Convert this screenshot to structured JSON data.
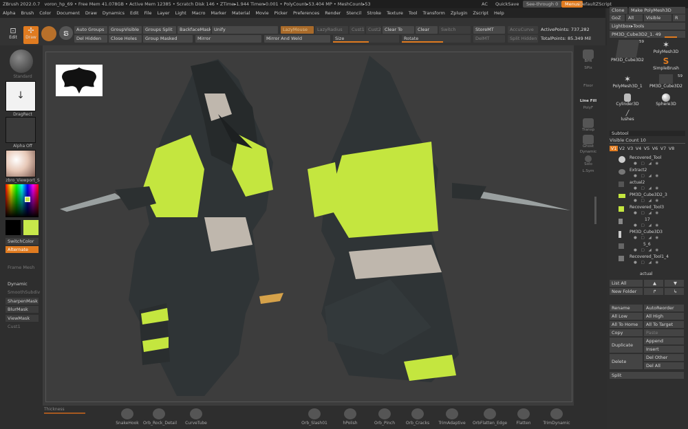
{
  "titlebar": {
    "app": "ZBrush 2022.0.7",
    "file": "voron_hp_69",
    "stats": "• Free Mem 41.078GB • Active Mem 12385 • Scratch Disk 146 • ZTime▸1.944 Timer▸0.001 • PolyCount▸53.404 MP • MeshCount▸53",
    "ac": "AC",
    "quicksave": "QuickSave",
    "seethrough": "See-through 0",
    "menus": "Menus",
    "script": "DefaultZScript"
  },
  "menubar": [
    "Alpha",
    "Brush",
    "Color",
    "Document",
    "Draw",
    "Dynamics",
    "Edit",
    "File",
    "Layer",
    "Light",
    "Macro",
    "Marker",
    "Material",
    "Movie",
    "Picker",
    "Preferences",
    "Render",
    "Stencil",
    "Stroke",
    "Texture",
    "Tool",
    "Transform",
    "Zplugin",
    "Zscript",
    "Help"
  ],
  "toolbar": {
    "edit": "Edit",
    "draw": "Draw",
    "auto_groups": "Auto Groups",
    "group_visible": "GroupVisible",
    "groups_split": "Groups Split",
    "backface_mask": "BackfaceMask",
    "unify": "Unify",
    "lazy_mouse": "LazyMouse",
    "lazy_radius": "LazyRadius",
    "cust1": "Cust1",
    "cust2": "Cust2",
    "clear_to": "Clear To",
    "clear": "Clear",
    "switch": "Switch",
    "store_mt": "StoreMT",
    "accu_curve": "AccuCurve",
    "active_points": "ActivePoints: 737,282",
    "del_hidden": "Del Hidden",
    "close_holes": "Close Holes",
    "group_masked": "Group Masked",
    "mirror": "Mirror",
    "mirror_weld": "Mirror And Weld",
    "size": "Size",
    "rotate": "Rotate",
    "del_mt": "DelMT",
    "split_hidden": "Split Hidden",
    "total_points": "TotalPoints: 85.349 Mil"
  },
  "leftpanel": {
    "standard": "Standard",
    "dragrect": "DragRect",
    "alpha_off": "Alpha Off",
    "material": "zbro_Viewport_S",
    "switch_color": "SwitchColor",
    "alternate": "Alternate",
    "frame_mesh": "Frame Mesh",
    "dynamic": "Dynamic",
    "smooth_subdiv": "SmoothSubdiv",
    "sharpen_mask": "SharpenMask",
    "blur_mask": "BlurMask",
    "view_mask": "ViewMask",
    "cust1": "Cust1",
    "main_color": "#c7e84b"
  },
  "bottombar": {
    "thickness": "Thickness",
    "brushes": [
      "SnakeHook",
      "Orb_Rock_Detail",
      "CurveTube",
      "Orb_Slash01",
      "hPolish",
      "Orb_Pinch",
      "Orb_Cracks",
      "TrimAdaptive",
      "OrbFlatten_Edge",
      "Flatten",
      "TrimDynamic"
    ]
  },
  "rightstrip": [
    "BPR",
    "SPix",
    "Floor",
    "Line Fill",
    "PolyF",
    "Transp",
    "Ghost",
    "Dynamic",
    "Solo",
    "L.Sym"
  ],
  "rightpanel": {
    "top_clone": "Clone",
    "top_make": "Make PolyMesh3D",
    "goz": "GoZ",
    "all": "All",
    "visible": "Visible",
    "r": "R",
    "lightbox_tools": "Lightbox▸Tools",
    "current_tool": "PM3D_Cube3D2_1. 49",
    "tools": [
      {
        "name": "PM3D_Cube3D2",
        "count": "59"
      },
      {
        "name": "PolyMesh3D",
        "count": ""
      },
      {
        "name": "SimpleBrush",
        "count": ""
      },
      {
        "name": "PolyMesh3D_1",
        "count": ""
      },
      {
        "name": "PM3D_Cube3D2",
        "count": "59"
      },
      {
        "name": "Cylinder3D",
        "count": ""
      },
      {
        "name": "Sphere3D",
        "count": ""
      },
      {
        "name": "lushes",
        "count": ""
      }
    ],
    "subtool": "Subtool",
    "visible_count": "Visible Count 10",
    "versions": [
      "V1",
      "V2",
      "V3",
      "V4",
      "V5",
      "V6",
      "V7",
      "V8"
    ],
    "subtools": [
      "Recovered_Tool",
      "Extract2",
      "actual2",
      "PM3D_Cube3D2_3",
      "Recovered_Tool3",
      "17",
      "PM3D_Cube3D3",
      "5_6",
      "Recovered_Tool1_4",
      "actual"
    ],
    "list_all": "List All",
    "new_folder": "New Folder",
    "rename": "Rename",
    "auto_reorder": "AutoReorder",
    "all_low": "All Low",
    "all_high": "All High",
    "all_to_home": "All To Home",
    "all_to_target": "All To Target",
    "copy": "Copy",
    "paste": "Paste",
    "duplicate": "Duplicate",
    "append": "Append",
    "insert": "Insert",
    "delete": "Delete",
    "del_other": "Del Other",
    "del_all": "Del All",
    "split": "Split"
  }
}
